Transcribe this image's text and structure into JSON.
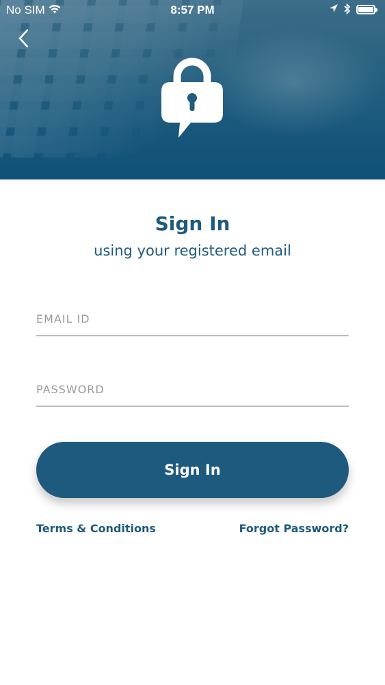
{
  "status_bar": {
    "carrier": "No SIM",
    "time": "8:57 PM",
    "icons": [
      "wifi-icon",
      "location-arrow-icon",
      "bluetooth-icon",
      "battery-icon"
    ]
  },
  "header": {
    "back_icon": "chevron-left-icon",
    "hero_icon": "lock-speech-bubble-icon"
  },
  "main": {
    "title": "Sign In",
    "subtitle": "using your registered email"
  },
  "form": {
    "email_placeholder": "EMAIL ID",
    "email_value": "",
    "password_placeholder": "PASSWORD",
    "password_value": "",
    "submit_label": "Sign In"
  },
  "links": {
    "terms": "Terms & Conditions",
    "forgot": "Forgot Password?"
  },
  "colors": {
    "brand": "#1e5a7d",
    "underline": "#bdbdbd",
    "placeholder": "#9a9a9a"
  }
}
